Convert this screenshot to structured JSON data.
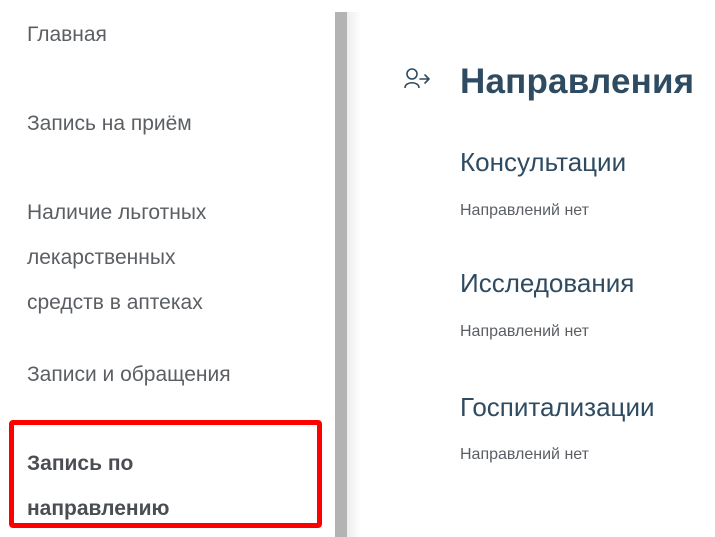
{
  "sidebar": {
    "items": [
      {
        "label": "Главная"
      },
      {
        "label": "Запись на приём"
      },
      {
        "lines": [
          "Наличие льготных",
          "лекарственных",
          "средств в аптеках"
        ]
      },
      {
        "label": "Записи и обращения"
      },
      {
        "lines": [
          "Запись по",
          "направлению"
        ],
        "active": true
      }
    ]
  },
  "main": {
    "icon": "referral-person-arrow-icon",
    "title": "Направления",
    "sections": [
      {
        "heading": "Консультации",
        "status": "Направлений нет"
      },
      {
        "heading": "Исследования",
        "status": "Направлений нет"
      },
      {
        "heading": "Госпитализации",
        "status": "Направлений нет"
      }
    ]
  },
  "colors": {
    "heading": "#2f4b61",
    "text": "#5b5f63",
    "highlight": "#ff0000",
    "divider": "#b3b3b3"
  }
}
